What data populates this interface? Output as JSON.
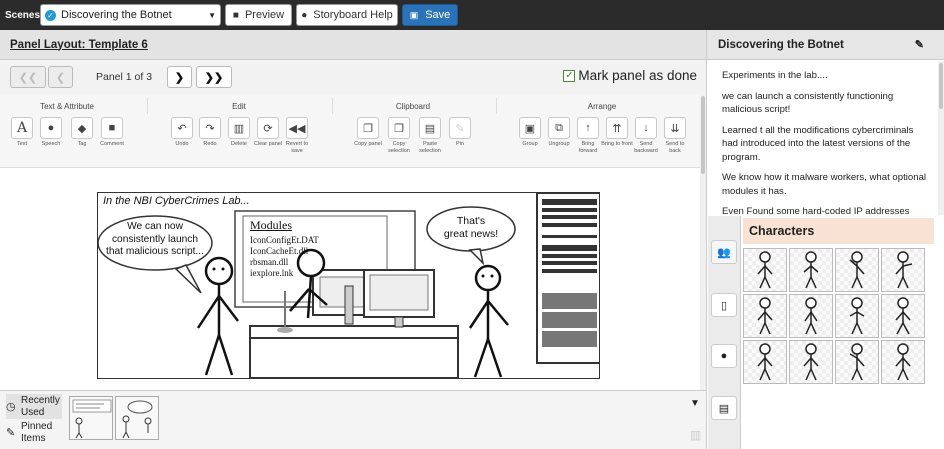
{
  "topbar": {
    "scenes_label": "Scenes",
    "scene_selected": "Discovering the Botnet",
    "preview_label": "Preview",
    "help_label": "Storyboard Help",
    "save_label": "Save"
  },
  "editor": {
    "panel_layout": "Panel Layout: Template 6",
    "panel_counter": "Panel 1 of 3",
    "mark_done_label": "Mark panel as done",
    "mark_done_checked": true
  },
  "ribbon": {
    "groups": [
      "Text & Attribute",
      "Edit",
      "Clipboard",
      "Arrange"
    ],
    "text_tools": [
      "Text",
      "Speech",
      "Tag",
      "Comment"
    ],
    "edit_tools": [
      "Undo",
      "Redo",
      "Delete",
      "Clear panel",
      "Revert to save"
    ],
    "clipboard_tools": [
      "Copy panel",
      "Copy selection",
      "Paste selection",
      "Pin"
    ],
    "arrange_tools": [
      "Group",
      "Ungroup",
      "Bring forward",
      "Bring to front",
      "Send backward",
      "Send to back"
    ]
  },
  "comic": {
    "caption": "In the NBI CyberCrimes Lab...",
    "bubble_left": [
      "We can now",
      "consistently launch",
      "that malicious script..."
    ],
    "bubble_right": [
      "That's",
      "great news!"
    ],
    "modules_title": "Modules",
    "modules": [
      "IconConfigEt.DAT",
      "IconCacheEt.dll",
      "rbsman.dll",
      "iexplore.lnk"
    ]
  },
  "tray": {
    "recently_used": "Recently Used",
    "pinned_items": "Pinned Items"
  },
  "sidebar": {
    "title": "Discovering the Botnet",
    "notes": [
      "Experiments in the lab....",
      "we can launch a consistently functioning malicious script!",
      "Learned t all the modifications cybercriminals had introduced into the latest versions of the program.",
      "We know how it malware workers, what optional modules it has.",
      "Even Found some hard-coded IP addresses"
    ],
    "characters_title": "Characters"
  },
  "colors": {
    "topbar": "#2b2b2b",
    "save": "#2a73b8",
    "characters_header": "#f8e2d3"
  }
}
